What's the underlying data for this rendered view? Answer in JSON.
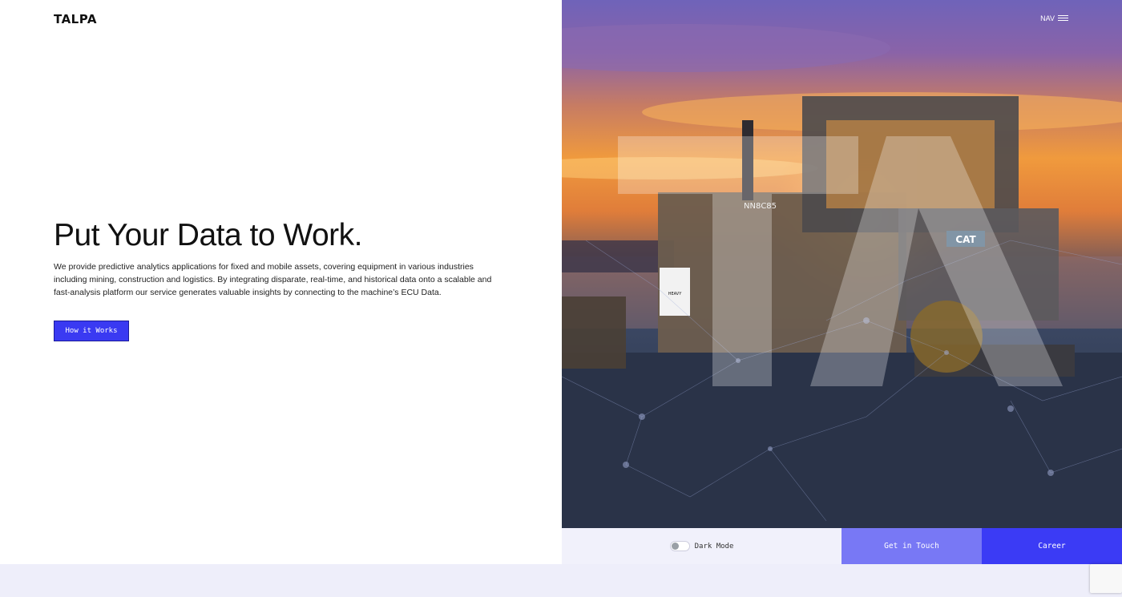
{
  "brand": {
    "logo": "TALPA"
  },
  "nav": {
    "label": "NAV"
  },
  "hero": {
    "title": "Put Your Data to Work.",
    "description": "We provide predictive analytics applications for fixed and mobile assets, covering equipment in various industries including mining, construction and logistics. By integrating disparate, real-time, and historical data onto a scalable and fast-analysis platform our service generates valuable insights by connecting to the machine’s ECU Data.",
    "cta_label": "How it Works"
  },
  "image": {
    "overlay_letters": "TA",
    "dozer_id": "NN8C85",
    "brand_badge": "CAT",
    "rental_sign": [
      "HEAVY",
      "EQUIPMENT",
      "RENTALS"
    ]
  },
  "bottom_bar": {
    "dark_mode_label": "Dark Mode",
    "dark_mode_on": false,
    "get_in_touch_label": "Get in Touch",
    "career_label": "Career"
  },
  "colors": {
    "accent": "#3b3bf5",
    "accent_light": "#7878f5",
    "panel_bg": "#f1f1fb"
  }
}
